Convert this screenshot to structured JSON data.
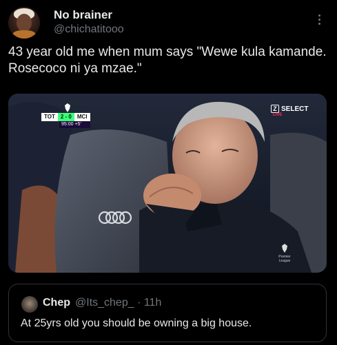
{
  "post": {
    "author": {
      "display_name": "No brainer",
      "handle": "@chichatitooo"
    },
    "text": "43 year old me when mum says \"Wewe kula kamande. Rosecoco ni ya mzae.\""
  },
  "media": {
    "scorebug": {
      "home": "TOT",
      "score": "2 - 0",
      "away": "MCI",
      "clock": "95:00 +5'"
    },
    "broadcaster": {
      "name": "SELECT",
      "badge": "LIVE"
    },
    "watermark": "Premier League",
    "ad_board": "Audi"
  },
  "quoted_post": {
    "author": {
      "display_name": "Chep",
      "handle_time": "@Its_chep_ · 11h"
    },
    "text": "At 25yrs old you should be owning a big house."
  },
  "colors": {
    "background": "#000000",
    "text_primary": "#e7e9ea",
    "text_secondary": "#71767b",
    "border": "#2f3336",
    "score_green": "#3cff7a"
  }
}
